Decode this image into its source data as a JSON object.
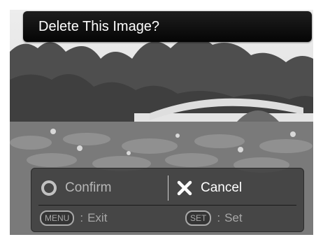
{
  "header": {
    "title": "Delete This Image?"
  },
  "dialog": {
    "confirm_label": "Confirm",
    "cancel_label": "Cancel",
    "selected": "cancel",
    "hints": [
      {
        "button": "MENU",
        "separator": ":",
        "action": "Exit"
      },
      {
        "button": "SET",
        "separator": ":",
        "action": "Set"
      }
    ]
  },
  "icons": {
    "confirm": "radio-circle-icon",
    "cancel": "x-icon"
  },
  "colors": {
    "title_bar": "#0a0a0a",
    "dialog_bg": "#3a3a3a",
    "selected_text": "#ffffff",
    "dimmed_text": "#b7b7b7"
  }
}
